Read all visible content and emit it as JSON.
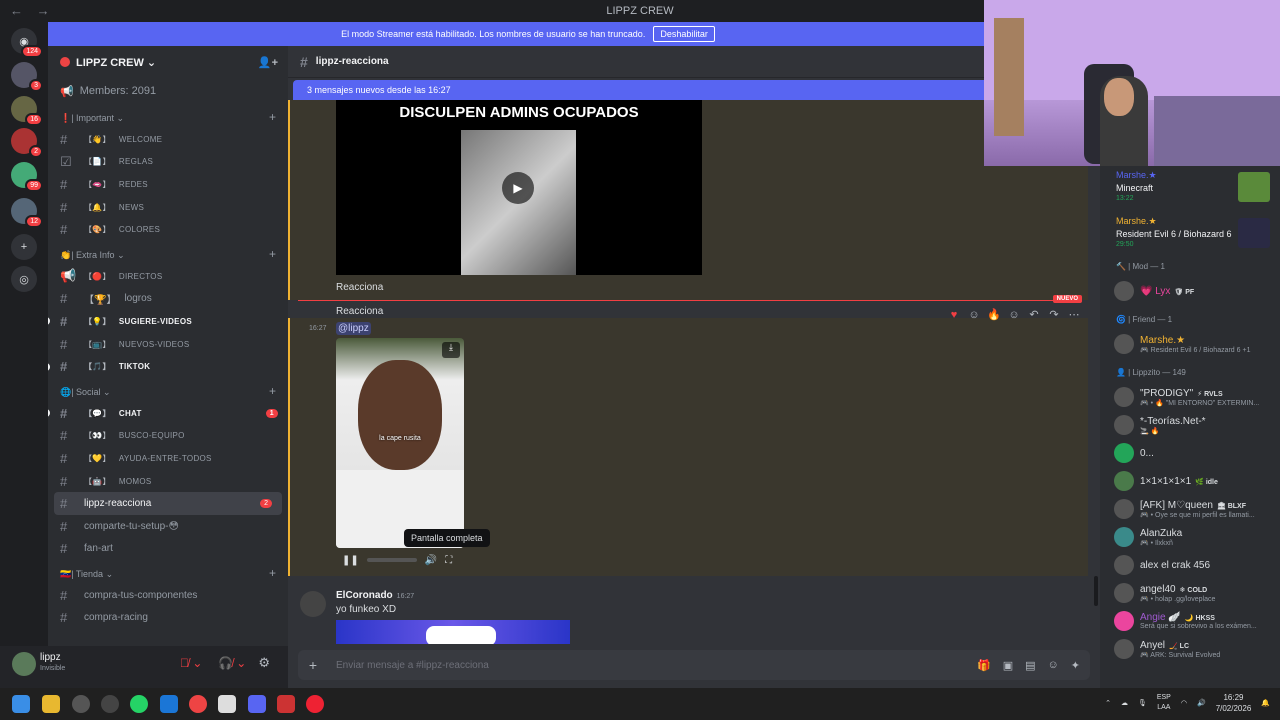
{
  "window": {
    "title": "LIPPZ CREW",
    "back": "←",
    "forward": "→"
  },
  "banner": {
    "text": "El modo Streamer está habilitado. Los nombres de usuario se han truncado.",
    "button": "Deshabilitar"
  },
  "servers": [
    {
      "icon": "discord-home-icon",
      "glyph": "◉",
      "badge": "124"
    },
    {
      "icon": "server-1-icon",
      "glyph": "●",
      "badge": "3"
    },
    {
      "icon": "server-2-icon",
      "glyph": "●",
      "badge": "16"
    },
    {
      "icon": "server-3-icon",
      "glyph": "●",
      "badge": "2"
    },
    {
      "icon": "server-4-icon",
      "glyph": "●",
      "badge": "99"
    },
    {
      "icon": "server-5-icon",
      "glyph": "●",
      "badge": "12"
    },
    {
      "icon": "add-server-icon",
      "glyph": "+",
      "badge": ""
    },
    {
      "icon": "explore-icon",
      "glyph": "◎",
      "badge": ""
    }
  ],
  "guild": {
    "name": "LIPPZ CREW ⌄",
    "members": "Members: 2091"
  },
  "categories": {
    "important": "❗| Important ⌄",
    "extra": "👏| Extra Info ⌄",
    "social": "🌐| Social ⌄",
    "tienda": "🇻🇪| Tienda ⌄"
  },
  "channels": {
    "welcome": {
      "emo": "【👋】",
      "name": "welcome"
    },
    "reglas": {
      "emo": "【📄】",
      "name": "reglas"
    },
    "redes": {
      "emo": "【🫦】",
      "name": "redes"
    },
    "news": {
      "emo": "【🔔】",
      "name": "news"
    },
    "colores": {
      "emo": "【🎨】",
      "name": "colores"
    },
    "directos": {
      "emo": "【🔴】",
      "name": "directos"
    },
    "logros": {
      "emo": "【🏆】",
      "name": "logros"
    },
    "sugiere": {
      "emo": "【💡】",
      "name": "sugiere-videos"
    },
    "nuevos": {
      "emo": "【📺】",
      "name": "nuevos-videos"
    },
    "tiktok": {
      "emo": "【🎵】",
      "name": "tiktok"
    },
    "chat": {
      "emo": "【💬】",
      "name": "chat",
      "mention": "1"
    },
    "busco": {
      "emo": "【👀】",
      "name": "busco-equipo"
    },
    "ayuda": {
      "emo": "【💛】",
      "name": "ayuda-entre-todos"
    },
    "momos": {
      "emo": "【🤖】",
      "name": "momos"
    },
    "reacciona": {
      "name": "lippz-reacciona",
      "mention": "2"
    },
    "setup": {
      "name": "comparte-tu-setup-😳"
    },
    "fanart": {
      "name": "fan-art"
    },
    "componentes": {
      "name": "compra-tus-componentes"
    },
    "racing": {
      "name": "compra-racing"
    }
  },
  "user": {
    "name": "lippz",
    "status": "Invisible"
  },
  "chat": {
    "header": "lippz-reacciona",
    "new_bar": "3 mensajes nuevos desde las 16:27",
    "video1_caption": "DISCULPEN ADMINS OCUPADOS",
    "msg1": "Reacciona",
    "new_label": "NUEVO",
    "msg2": "Reacciona",
    "time1": "16:27",
    "mention": "@lippz",
    "video2_caption": "la cape rusita",
    "tooltip": "Pantalla completa",
    "author": "ElCoronado",
    "author_time": "16:27",
    "msg3": "yo funkeo XD",
    "composer_placeholder": "Enviar mensaje a #lippz-reacciona"
  },
  "members": {
    "activity1": {
      "name": "Marshe.★",
      "game": "Minecraft",
      "time": "13:22"
    },
    "activity2": {
      "name": "Marshe.★",
      "game": "Resident Evil 6 / Biohazard 6",
      "time": "29:50"
    },
    "group_mod": "🔨 | Mod — 1",
    "mod1": {
      "name": "💗 Lyx",
      "tag": "🛡 PF"
    },
    "group_friend": "🌀 | Friend — 1",
    "friend1": {
      "name": "Marshe.★",
      "status": "🎮 Resident Evil 6 / Biohazard 6 +1"
    },
    "group_lippzito": "👤 | Lippzito — 149",
    "list": [
      {
        "name": "\"PRODIGY\"",
        "tag": "⚡ RVLS",
        "status": "🎮 • 🔥 \"MI ENTORNO\" EXTERMIN..."
      },
      {
        "name": "*-Teorías.Net-*",
        "tag": "",
        "status": "🚬 🔥"
      },
      {
        "name": "0...",
        "tag": "",
        "status": ""
      },
      {
        "name": "1×1×1×1×1",
        "tag": "🌿 idle",
        "status": ""
      },
      {
        "name": "[AFK] M♡queen",
        "tag": "🏛 BLXF",
        "status": "🎮 • Oye se que mi perfil es llamati..."
      },
      {
        "name": "AlanZuka",
        "tag": "",
        "status": "🎮 • Ilxkxñ"
      },
      {
        "name": "alex el crak 456",
        "tag": "",
        "status": ""
      },
      {
        "name": "angel40",
        "tag": "❄ COLD",
        "status": "🎮 • holap .gg/loveplace"
      },
      {
        "name": "Angie 🪽",
        "tag": "🌙 HKSS",
        "status": "Será que si sobrevivo a los exámen..."
      },
      {
        "name": "Anyel",
        "tag": "🏒 LC",
        "status": "🎮 ARK: Survival Evolved"
      }
    ]
  },
  "taskbar": {
    "lang1": "ESP",
    "lang2": "LAA",
    "time": "16:29",
    "date": "7/02/2026"
  },
  "colors": {
    "accent": "#5865f2",
    "danger": "#f23f43",
    "online": "#23a559"
  }
}
